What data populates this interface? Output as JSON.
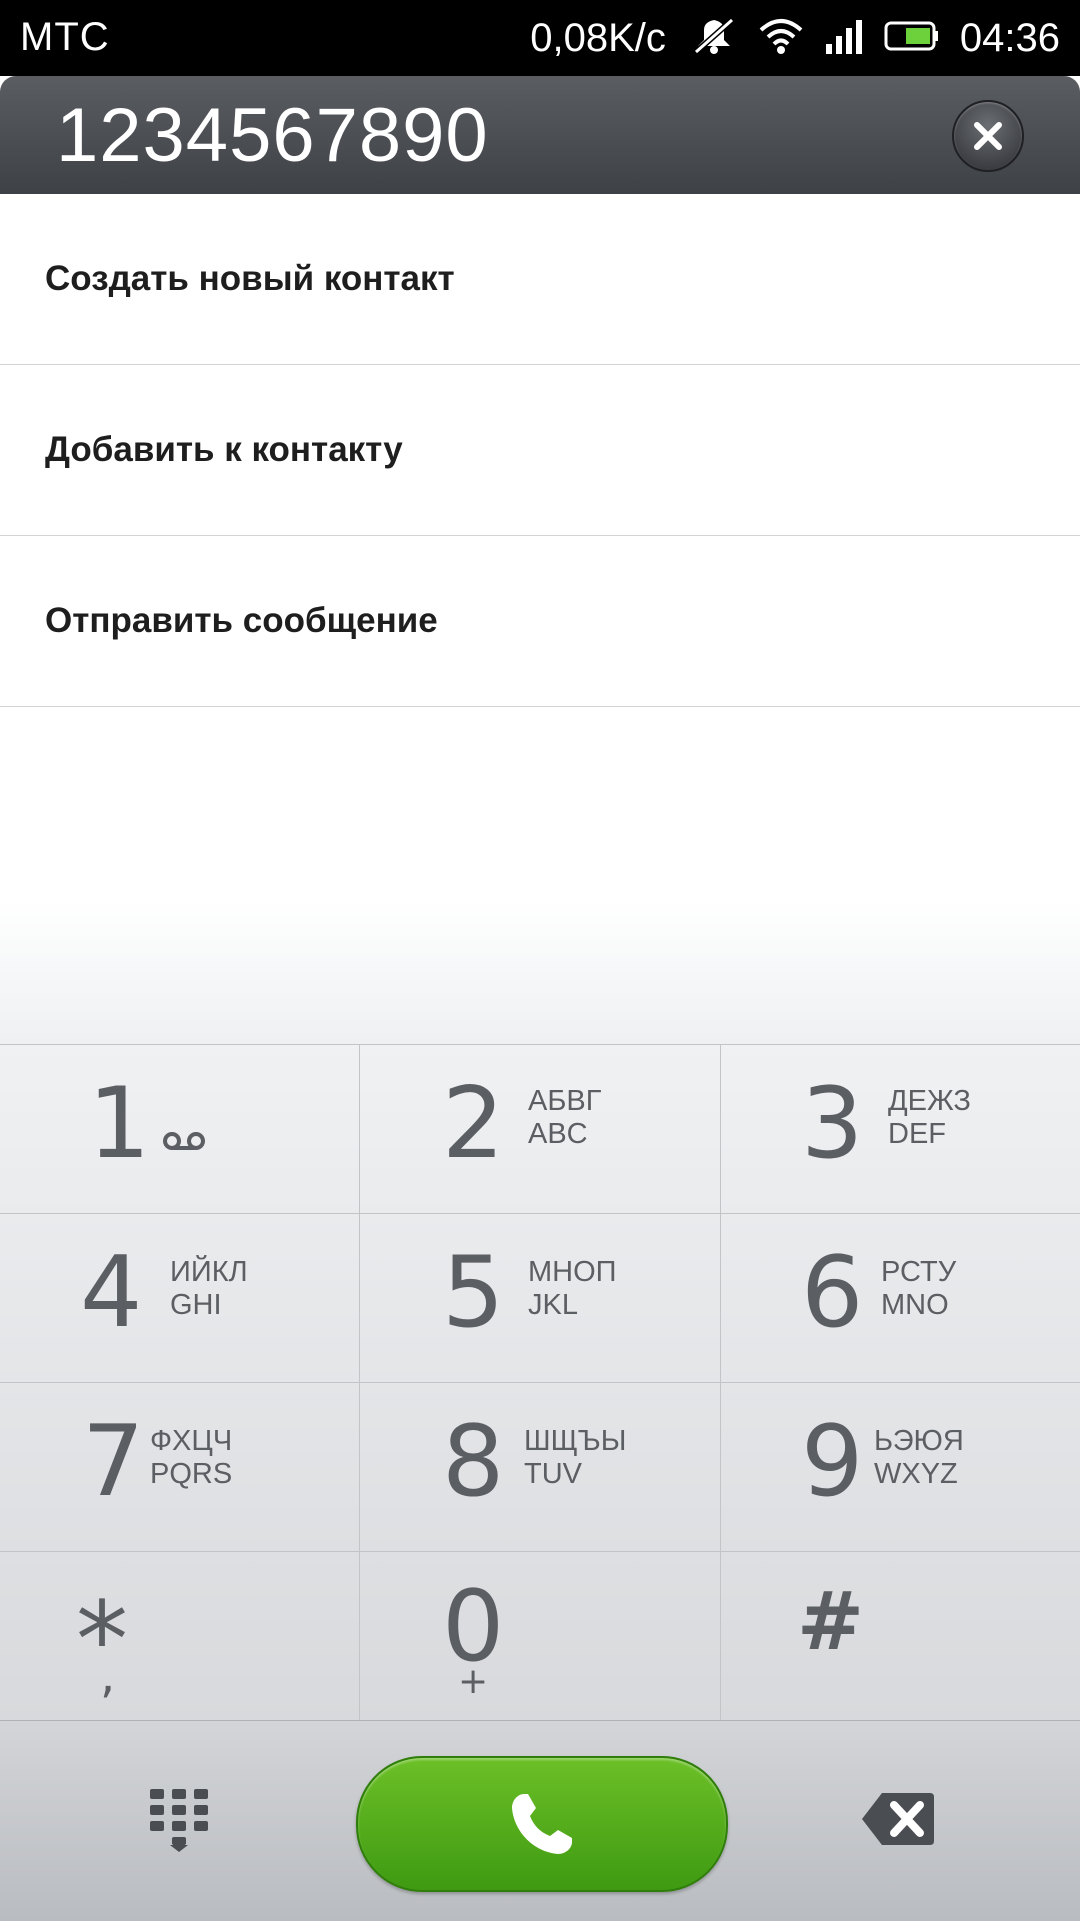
{
  "status_bar": {
    "carrier": "МТС",
    "net_speed": "0,08K/c",
    "time": "04:36",
    "icons": [
      "mute-icon",
      "wifi-icon",
      "signal-icon",
      "battery-icon"
    ]
  },
  "dialer": {
    "number": "1234567890"
  },
  "options": [
    {
      "label": "Создать новый контакт"
    },
    {
      "label": "Добавить к контакту"
    },
    {
      "label": "Отправить сообщение"
    }
  ],
  "keypad": {
    "keys": [
      {
        "digit": "1",
        "ru": "",
        "en": "",
        "sub_icon": "voicemail-icon"
      },
      {
        "digit": "2",
        "ru": "АБВГ",
        "en": "ABC"
      },
      {
        "digit": "3",
        "ru": "ДЕЖЗ",
        "en": "DEF"
      },
      {
        "digit": "4",
        "ru": "ИЙКЛ",
        "en": "GHI"
      },
      {
        "digit": "5",
        "ru": "МНОП",
        "en": "JKL"
      },
      {
        "digit": "6",
        "ru": "РСТУ",
        "en": "MNO"
      },
      {
        "digit": "7",
        "ru": "ФХЦЧ",
        "en": "PQRS"
      },
      {
        "digit": "8",
        "ru": "ШЩЪЫ",
        "en": "TUV"
      },
      {
        "digit": "9",
        "ru": "ЬЭЮЯ",
        "en": "WXYZ"
      },
      {
        "digit": "*",
        "sub": ","
      },
      {
        "digit": "0",
        "sub": "+"
      },
      {
        "digit": "#"
      }
    ]
  },
  "bottom_bar": {
    "icons": [
      "dialpad-icon",
      "phone-icon",
      "backspace-icon"
    ]
  },
  "colors": {
    "call_green": "#4faa1a",
    "header_dark": "#45484d",
    "key_text": "#5b5e62"
  }
}
